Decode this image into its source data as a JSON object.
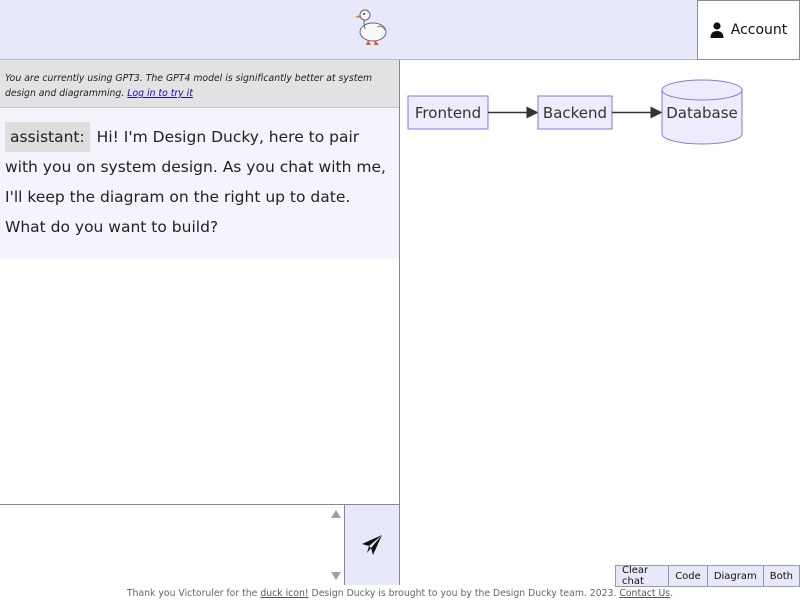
{
  "header": {
    "account_label": "Account",
    "logo_icon": "duck-icon",
    "account_icon": "user-icon"
  },
  "notice": {
    "text": "You are currently using GPT3. The GPT4 model is significantly better at system design and diagramming.",
    "link": "Log in to try it"
  },
  "messages": [
    {
      "role": "assistant:",
      "text": "Hi! I'm Design Ducky, here to pair with you on system design. As you chat with me, I'll keep the diagram on the right up to date. What do you want to build?"
    }
  ],
  "composer": {
    "value": "",
    "send_icon": "send-icon"
  },
  "diagram": {
    "nodes": [
      {
        "label": "Frontend",
        "shape": "rect"
      },
      {
        "label": "Backend",
        "shape": "rect"
      },
      {
        "label": "Database",
        "shape": "cylinder"
      }
    ],
    "edges": [
      {
        "from": "Frontend",
        "to": "Backend"
      },
      {
        "from": "Backend",
        "to": "Database"
      }
    ],
    "node_fill": "#ececfd",
    "node_stroke": "#9370db"
  },
  "view_buttons": {
    "clear": "Clear chat",
    "code": "Code",
    "diagram": "Diagram",
    "both": "Both"
  },
  "footer": {
    "part1": "Thank you Victoruler for the ",
    "duck_link": "duck icon!",
    "part2": " Design Ducky is brought to you by the Design Ducky team. 2023. ",
    "contact_link": "Contact Us",
    "part3": "."
  },
  "colors": {
    "header_bg": "#e8e8fb",
    "notice_bg": "#e2e2e2",
    "message_bg": "#f4f4fd",
    "role_tag_bg": "#dddddd"
  }
}
